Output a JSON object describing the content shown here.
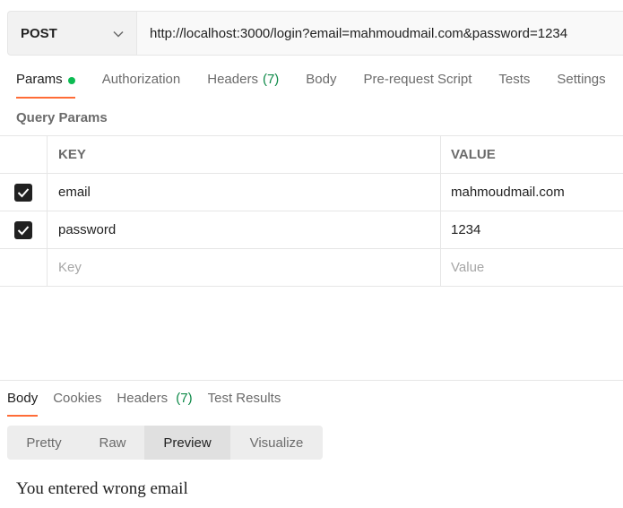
{
  "request": {
    "method": "POST",
    "url": "http://localhost:3000/login?email=mahmoudmail.com&password=1234"
  },
  "request_tabs": {
    "params": "Params",
    "authorization": "Authorization",
    "headers": "Headers",
    "headers_count": "(7)",
    "body": "Body",
    "prerequest": "Pre-request Script",
    "tests": "Tests",
    "settings": "Settings"
  },
  "query_params": {
    "title": "Query Params",
    "key_header": "KEY",
    "value_header": "VALUE",
    "rows": [
      {
        "key": "email",
        "value": "mahmoudmail.com",
        "checked": true
      },
      {
        "key": "password",
        "value": "1234",
        "checked": true
      }
    ],
    "key_placeholder": "Key",
    "value_placeholder": "Value"
  },
  "response_tabs": {
    "body": "Body",
    "cookies": "Cookies",
    "headers": "Headers",
    "headers_count": "(7)",
    "test_results": "Test Results"
  },
  "view_modes": {
    "pretty": "Pretty",
    "raw": "Raw",
    "preview": "Preview",
    "visualize": "Visualize"
  },
  "response_preview": "You entered wrong email",
  "colors": {
    "accent": "#ff6c37",
    "status_dot": "#0cbb52",
    "count_green": "#0f8a49"
  },
  "icons": {
    "method_dropdown": "chevron-down-icon",
    "checkbox": "checkmark-icon"
  }
}
